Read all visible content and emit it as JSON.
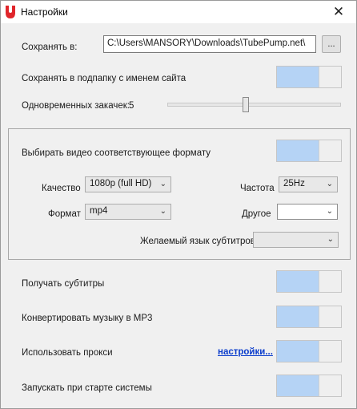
{
  "window": {
    "title": "Настройки",
    "close_glyph": "✕",
    "logo_icon": "tubepump-logo",
    "logo_color": "#e0262b"
  },
  "save_to": {
    "label": "Сохранять в:",
    "path": "C:\\Users\\MANSORY\\Downloads\\TubePump.net\\",
    "browse_label": "..."
  },
  "subfolder": {
    "label": "Сохранять в подпапку с именем сайта",
    "enabled": true
  },
  "downloads": {
    "label": "Одновременных закачек:",
    "value": "5",
    "level": 0.5
  },
  "format_group": {
    "match_format": {
      "label": "Выбирать видео соответствующее формату",
      "enabled": true
    },
    "quality": {
      "label": "Качество",
      "value": "1080p (full HD)"
    },
    "fps": {
      "label": "Частота",
      "value": "25Hz"
    },
    "format": {
      "label": "Формат",
      "value": "mp4"
    },
    "other": {
      "label": "Другое",
      "value": ""
    },
    "subtitle_lang": {
      "label": "Желаемый язык субтитров",
      "value": ""
    }
  },
  "options": {
    "subtitles": {
      "label": "Получать субтитры",
      "enabled": true
    },
    "mp3": {
      "label": "Конвертировать музыку в MP3",
      "enabled": true
    },
    "proxy": {
      "label": "Использовать прокси",
      "link": "настройки...",
      "enabled": true
    },
    "autostart": {
      "label": "Запускать при старте системы",
      "enabled": true
    }
  },
  "colors": {
    "toggle_on": "#b5d3f5",
    "link": "#0a3ccc"
  }
}
